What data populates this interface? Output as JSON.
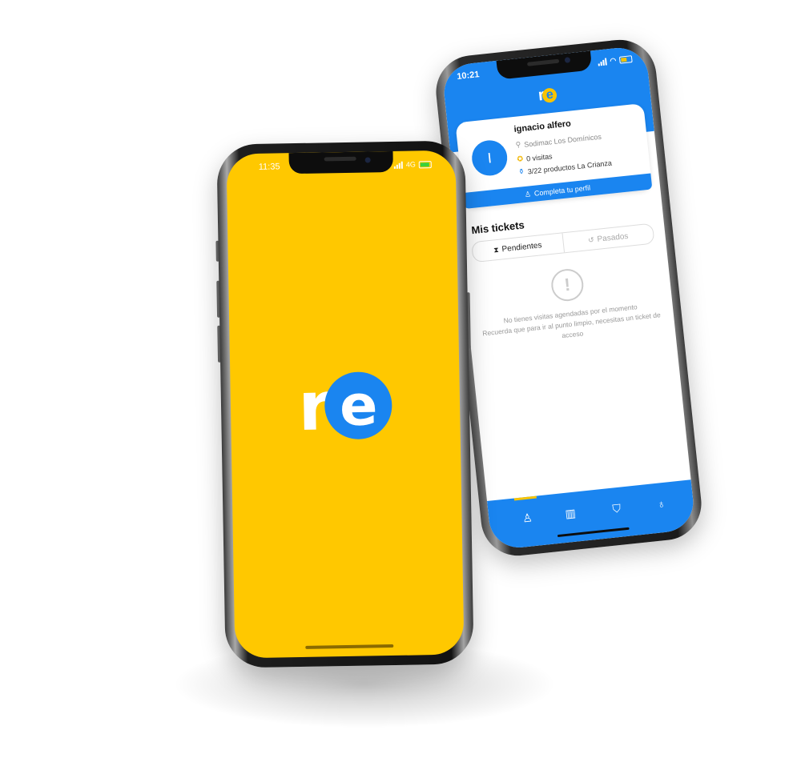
{
  "back_phone": {
    "status": {
      "time": "10:21"
    },
    "logo": {
      "r": "r",
      "e": "e"
    },
    "profile": {
      "avatar_initial": "I",
      "name": "ignacio  alfero",
      "store": "Sodimac Los Domínicos",
      "visits": "0 visitas",
      "products": "3/22 productos La Crianza",
      "complete_button": "Completa tu perfil"
    },
    "tickets": {
      "title": "Mis tickets",
      "tab_pending": "Pendientes",
      "tab_past": "Pasados",
      "empty_line1": "No tienes visitas agendadas por el momento",
      "empty_line2": "Recuerda que para ir al punto limpio, necesitas un ticket de acceso"
    },
    "tabbar": {
      "icons": [
        "profile-icon",
        "scan-icon",
        "bag-icon",
        "lightbulb-icon"
      ]
    },
    "colors": {
      "primary": "#1a85f0",
      "accent": "#f8c400"
    }
  },
  "front_phone": {
    "status": {
      "time": "11:35",
      "network": "4G"
    },
    "logo": {
      "r": "r",
      "e": "e"
    },
    "colors": {
      "background": "#ffc800",
      "logo_circle": "#1a85f0"
    }
  }
}
